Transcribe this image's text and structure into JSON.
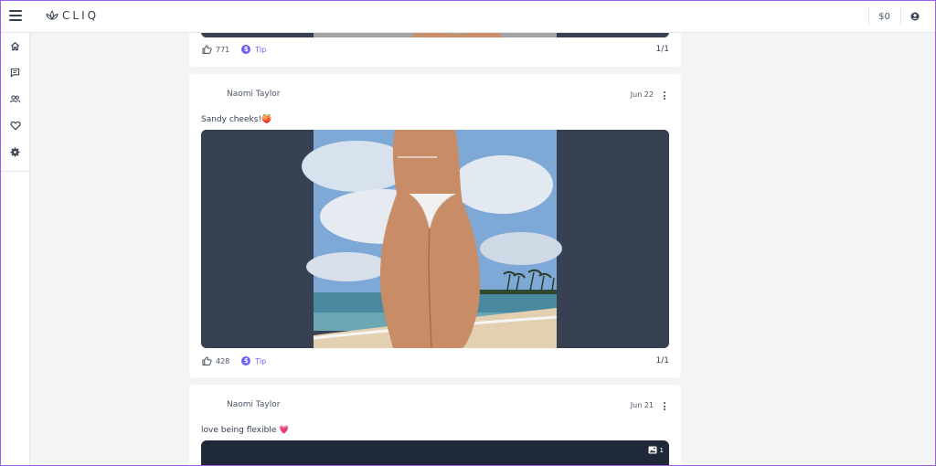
{
  "header": {
    "brand_name": "CLIQ",
    "balance": "$0"
  },
  "sidebar": {
    "items": [
      {
        "icon": "home-icon"
      },
      {
        "icon": "messages-icon"
      },
      {
        "icon": "users-icon"
      },
      {
        "icon": "heart-icon"
      },
      {
        "icon": "gear-icon"
      }
    ]
  },
  "posts": [
    {
      "likes": "771",
      "tip_label": "Tip",
      "tip_symbol": "$",
      "pager": "1/1"
    },
    {
      "author": "Naomi Taylor",
      "date": "Jun 22",
      "caption": "Sandy cheeks!🍑",
      "likes": "428",
      "tip_label": "Tip",
      "tip_symbol": "$",
      "pager": "1/1"
    },
    {
      "author": "Naomi Taylor",
      "date": "Jun 21",
      "caption": "love being flexible 💗",
      "media_count": "1"
    }
  ],
  "colors": {
    "accent": "#6d5ef5",
    "media_bg": "#374151",
    "page_bg": "#f3f4f6"
  }
}
